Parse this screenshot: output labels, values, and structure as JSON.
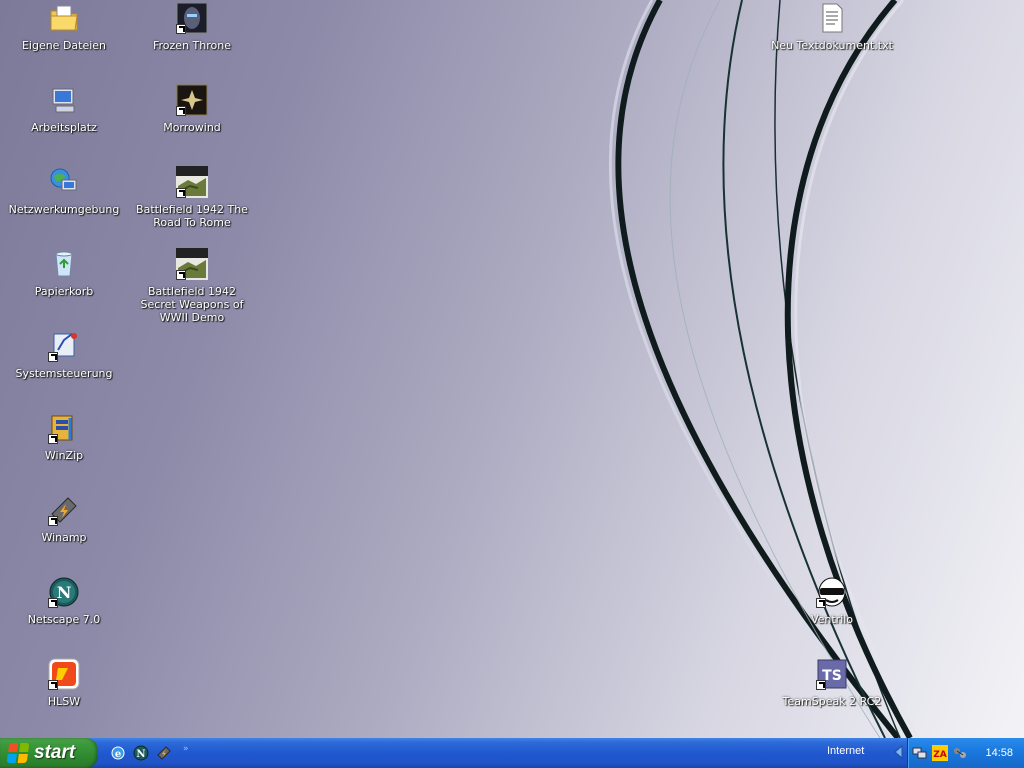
{
  "desktop": {
    "left_icons": [
      {
        "label": "Eigene Dateien",
        "icon": "my-documents-folder-icon"
      },
      {
        "label": "Arbeitsplatz",
        "icon": "my-computer-icon"
      },
      {
        "label": "Netzwerkumgebung",
        "icon": "network-places-icon"
      },
      {
        "label": "Papierkorb",
        "icon": "recycle-bin-icon"
      },
      {
        "label": "Systemsteuerung",
        "icon": "control-panel-icon"
      },
      {
        "label": "WinZip",
        "icon": "winzip-icon"
      },
      {
        "label": "Winamp",
        "icon": "winamp-icon"
      },
      {
        "label": "Netscape 7.0",
        "icon": "netscape-icon"
      },
      {
        "label": "HLSW",
        "icon": "hlsw-icon"
      }
    ],
    "middle_icons": [
      {
        "label": "Frozen Throne",
        "icon": "frozen-throne-icon"
      },
      {
        "label": "Morrowind",
        "icon": "morrowind-icon"
      },
      {
        "label": "Battlefield 1942 The Road To Rome",
        "icon": "battlefield-1942-icon"
      },
      {
        "label": "Battlefield 1942 Secret Weapons of WWII Demo",
        "icon": "battlefield-1942-icon"
      }
    ],
    "right_icons": [
      {
        "label": "Neu Textdokument.txt",
        "icon": "text-document-icon"
      },
      {
        "label": "Ventrilo",
        "icon": "ventrilo-icon"
      },
      {
        "label": "TeamSpeak 2 RC2",
        "icon": "teamspeak-icon"
      }
    ]
  },
  "taskbar": {
    "start_label": "start",
    "quick_launch": [
      "internet-explorer-icon",
      "netscape-icon",
      "winamp-icon"
    ],
    "toolbar_label": "Internet",
    "tray_icons": [
      "network-icon",
      "zonealarm-icon",
      "connection-icon"
    ],
    "clock": "14:58"
  }
}
